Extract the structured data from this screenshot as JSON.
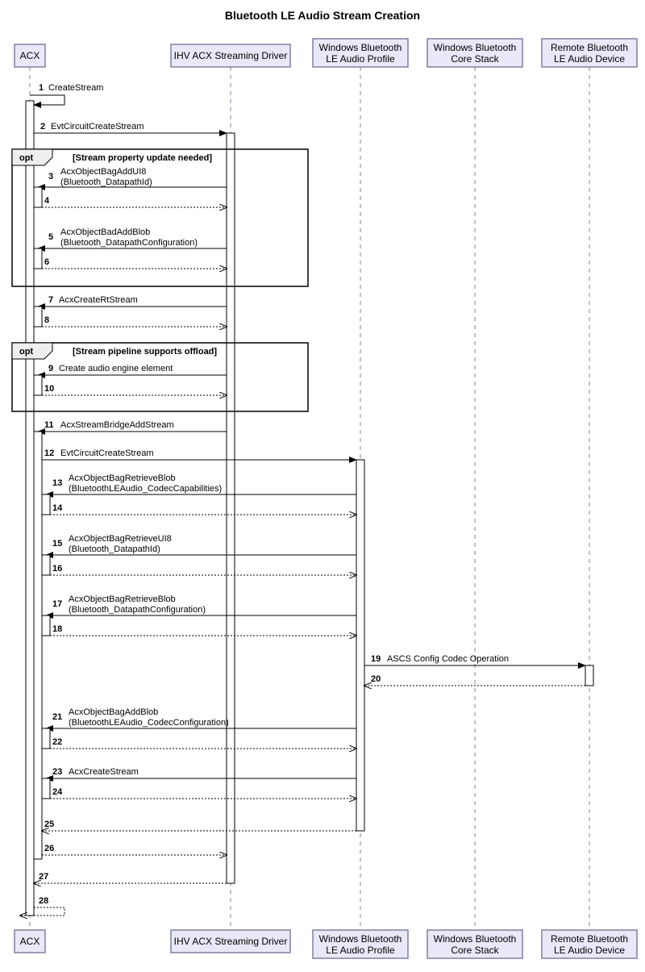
{
  "title": "Bluetooth LE Audio Stream Creation",
  "participants": {
    "p1": "ACX",
    "p2": "IHV ACX Streaming Driver",
    "p3_l1": "Windows Bluetooth",
    "p3_l2": "LE Audio Profile",
    "p4_l1": "Windows Bluetooth",
    "p4_l2": "Core Stack",
    "p5_l1": "Remote Bluetooth",
    "p5_l2": "LE Audio Device"
  },
  "opt1": {
    "label": "opt",
    "guard": "[Stream property update needed]"
  },
  "opt2": {
    "label": "opt",
    "guard": "[Stream pipeline supports offload]"
  },
  "messages": {
    "m1": {
      "n": "1",
      "t": "CreateStream"
    },
    "m2": {
      "n": "2",
      "t": "EvtCircuitCreateStream"
    },
    "m3": {
      "n": "3",
      "t1": "AcxObjectBagAddUI8",
      "t2": "(Bluetooth_DatapathId)"
    },
    "m4": {
      "n": "4",
      "t": ""
    },
    "m5": {
      "n": "5",
      "t1": "AcxObjectBadAddBlob",
      "t2": "(Bluetooth_DatapathConfiguration)"
    },
    "m6": {
      "n": "6",
      "t": ""
    },
    "m7": {
      "n": "7",
      "t": "AcxCreateRtStream"
    },
    "m8": {
      "n": "8",
      "t": ""
    },
    "m9": {
      "n": "9",
      "t": "Create audio engine element"
    },
    "m10": {
      "n": "10",
      "t": ""
    },
    "m11": {
      "n": "11",
      "t": "AcxStreamBridgeAddStream"
    },
    "m12": {
      "n": "12",
      "t": "EvtCircuitCreateStream"
    },
    "m13": {
      "n": "13",
      "t1": "AcxObjectBagRetrieveBlob",
      "t2": "(BluetoothLEAudio_CodecCapabilities)"
    },
    "m14": {
      "n": "14",
      "t": ""
    },
    "m15": {
      "n": "15",
      "t1": "AcxObjectBagRetrieveUI8",
      "t2": "(Bluetooth_DatapathId)"
    },
    "m16": {
      "n": "16",
      "t": ""
    },
    "m17": {
      "n": "17",
      "t1": "AcxObjectBagRetrieveBlob",
      "t2": "(Bluetooth_DatapathConfiguration)"
    },
    "m18": {
      "n": "18",
      "t": ""
    },
    "m19": {
      "n": "19",
      "t": "ASCS Config Codec Operation"
    },
    "m20": {
      "n": "20",
      "t": ""
    },
    "m21": {
      "n": "21",
      "t1": "AcxObjectBagAddBlob",
      "t2": "(BluetoothLEAudio_CodecConfiguration)"
    },
    "m22": {
      "n": "22",
      "t": ""
    },
    "m23": {
      "n": "23",
      "t": "AcxCreateStream"
    },
    "m24": {
      "n": "24",
      "t": ""
    },
    "m25": {
      "n": "25",
      "t": ""
    },
    "m26": {
      "n": "26",
      "t": ""
    },
    "m27": {
      "n": "27",
      "t": ""
    },
    "m28": {
      "n": "28",
      "t": ""
    }
  },
  "chart_data": {
    "type": "sequence-diagram",
    "title": "Bluetooth LE Audio Stream Creation",
    "participants": [
      "ACX",
      "IHV ACX Streaming Driver",
      "Windows Bluetooth LE Audio Profile",
      "Windows Bluetooth Core Stack",
      "Remote Bluetooth LE Audio Device"
    ],
    "fragments": [
      {
        "type": "opt",
        "guard": "Stream property update needed",
        "covers_messages": [
          3,
          4,
          5,
          6
        ]
      },
      {
        "type": "opt",
        "guard": "Stream pipeline supports offload",
        "covers_messages": [
          9,
          10
        ]
      }
    ],
    "messages": [
      {
        "n": 1,
        "from": "ACX",
        "to": "ACX",
        "label": "CreateStream",
        "kind": "self-sync"
      },
      {
        "n": 2,
        "from": "ACX",
        "to": "IHV ACX Streaming Driver",
        "label": "EvtCircuitCreateStream",
        "kind": "sync"
      },
      {
        "n": 3,
        "from": "IHV ACX Streaming Driver",
        "to": "ACX",
        "label": "AcxObjectBagAddUI8(Bluetooth_DatapathId)",
        "kind": "sync"
      },
      {
        "n": 4,
        "from": "ACX",
        "to": "IHV ACX Streaming Driver",
        "label": "",
        "kind": "return"
      },
      {
        "n": 5,
        "from": "IHV ACX Streaming Driver",
        "to": "ACX",
        "label": "AcxObjectBadAddBlob(Bluetooth_DatapathConfiguration)",
        "kind": "sync"
      },
      {
        "n": 6,
        "from": "ACX",
        "to": "IHV ACX Streaming Driver",
        "label": "",
        "kind": "return"
      },
      {
        "n": 7,
        "from": "IHV ACX Streaming Driver",
        "to": "ACX",
        "label": "AcxCreateRtStream",
        "kind": "sync"
      },
      {
        "n": 8,
        "from": "ACX",
        "to": "IHV ACX Streaming Driver",
        "label": "",
        "kind": "return"
      },
      {
        "n": 9,
        "from": "IHV ACX Streaming Driver",
        "to": "ACX",
        "label": "Create audio engine element",
        "kind": "sync"
      },
      {
        "n": 10,
        "from": "ACX",
        "to": "IHV ACX Streaming Driver",
        "label": "",
        "kind": "return"
      },
      {
        "n": 11,
        "from": "IHV ACX Streaming Driver",
        "to": "ACX",
        "label": "AcxStreamBridgeAddStream",
        "kind": "sync"
      },
      {
        "n": 12,
        "from": "ACX",
        "to": "Windows Bluetooth LE Audio Profile",
        "label": "EvtCircuitCreateStream",
        "kind": "sync"
      },
      {
        "n": 13,
        "from": "Windows Bluetooth LE Audio Profile",
        "to": "ACX",
        "label": "AcxObjectBagRetrieveBlob(BluetoothLEAudio_CodecCapabilities)",
        "kind": "sync"
      },
      {
        "n": 14,
        "from": "ACX",
        "to": "Windows Bluetooth LE Audio Profile",
        "label": "",
        "kind": "return"
      },
      {
        "n": 15,
        "from": "Windows Bluetooth LE Audio Profile",
        "to": "ACX",
        "label": "AcxObjectBagRetrieveUI8(Bluetooth_DatapathId)",
        "kind": "sync"
      },
      {
        "n": 16,
        "from": "ACX",
        "to": "Windows Bluetooth LE Audio Profile",
        "label": "",
        "kind": "return"
      },
      {
        "n": 17,
        "from": "Windows Bluetooth LE Audio Profile",
        "to": "ACX",
        "label": "AcxObjectBagRetrieveBlob(Bluetooth_DatapathConfiguration)",
        "kind": "sync"
      },
      {
        "n": 18,
        "from": "ACX",
        "to": "Windows Bluetooth LE Audio Profile",
        "label": "",
        "kind": "return"
      },
      {
        "n": 19,
        "from": "Windows Bluetooth LE Audio Profile",
        "to": "Remote Bluetooth LE Audio Device",
        "label": "ASCS Config Codec Operation",
        "kind": "sync"
      },
      {
        "n": 20,
        "from": "Remote Bluetooth LE Audio Device",
        "to": "Windows Bluetooth LE Audio Profile",
        "label": "",
        "kind": "return"
      },
      {
        "n": 21,
        "from": "Windows Bluetooth LE Audio Profile",
        "to": "ACX",
        "label": "AcxObjectBagAddBlob(BluetoothLEAudio_CodecConfiguration)",
        "kind": "sync"
      },
      {
        "n": 22,
        "from": "ACX",
        "to": "Windows Bluetooth LE Audio Profile",
        "label": "",
        "kind": "return"
      },
      {
        "n": 23,
        "from": "Windows Bluetooth LE Audio Profile",
        "to": "ACX",
        "label": "AcxCreateStream",
        "kind": "sync"
      },
      {
        "n": 24,
        "from": "ACX",
        "to": "Windows Bluetooth LE Audio Profile",
        "label": "",
        "kind": "return"
      },
      {
        "n": 25,
        "from": "Windows Bluetooth LE Audio Profile",
        "to": "ACX",
        "label": "",
        "kind": "return"
      },
      {
        "n": 26,
        "from": "ACX",
        "to": "IHV ACX Streaming Driver",
        "label": "",
        "kind": "return"
      },
      {
        "n": 27,
        "from": "IHV ACX Streaming Driver",
        "to": "ACX",
        "label": "",
        "kind": "return"
      },
      {
        "n": 28,
        "from": "ACX",
        "to": "ACX",
        "label": "",
        "kind": "self-return"
      }
    ]
  }
}
